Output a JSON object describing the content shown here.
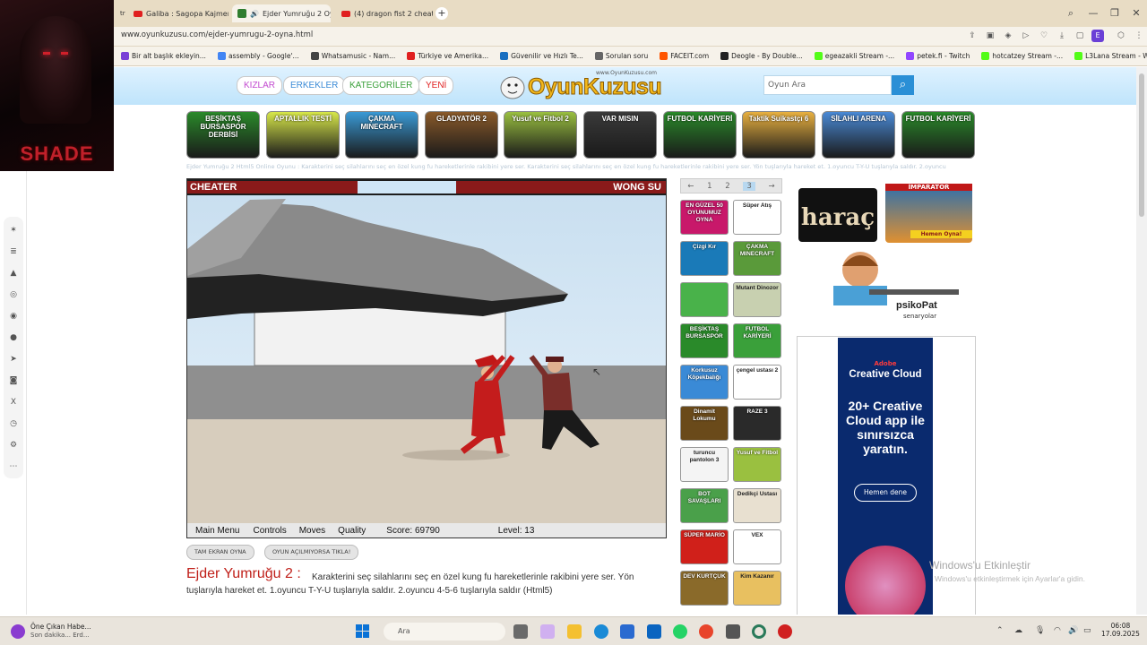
{
  "overlay": {
    "streamer_name": "SHADE"
  },
  "browser": {
    "tabs": [
      {
        "label": "Galiba : Sagopa Kajmer",
        "type": "youtube"
      },
      {
        "label": "Ejder Yumruğu 2 Oy",
        "type": "oyunkuzusu",
        "active": true
      },
      {
        "label": "(4) dragon fist 2 cheats",
        "type": "youtube"
      }
    ],
    "url": "www.oyunkuzusu.com/ejder-yumrugu-2-oyna.html",
    "profile_letter": "E",
    "bookmarks": [
      {
        "label": "Bir alt başlık ekleyin...",
        "color": "#7a3fd6"
      },
      {
        "label": "assembly - Google'...",
        "color": "#4285f4"
      },
      {
        "label": "Whatsamusic - Nam...",
        "color": "#444444"
      },
      {
        "label": "Türkiye ve Amerika...",
        "color": "#e02020"
      },
      {
        "label": "Güvenilir ve Hızlı Te...",
        "color": "#1a6fc0"
      },
      {
        "label": "Sorulan soru",
        "color": "#666666"
      },
      {
        "label": "FACEIT.com",
        "color": "#ff5500"
      },
      {
        "label": "Deogle - By Double...",
        "color": "#222222"
      },
      {
        "label": "egeazakli Stream -...",
        "color": "#53fc18"
      },
      {
        "label": "petek.fi - Twitch",
        "color": "#9146ff"
      },
      {
        "label": "hotcatzey Stream -...",
        "color": "#53fc18"
      },
      {
        "label": "L3Lana Stream - Wa...",
        "color": "#53fc18"
      }
    ]
  },
  "site": {
    "nav": {
      "kizlar": "KIZLAR",
      "erkekler": "ERKEKLER",
      "kategoriler": "KATEGORİLER",
      "yeni": "YENİ"
    },
    "logo": "OyunKuzusu",
    "logo_small": "www.OyunKuzusu.com",
    "search_placeholder": "Oyun Ara",
    "top_games": [
      {
        "label": "BEŞİKTAŞ BURSASPOR DERBİSİ",
        "color": "#2a8a2a"
      },
      {
        "label": "APTALLIK TESTİ",
        "color": "#d8e84a"
      },
      {
        "label": "ÇAKMA MINECRAFT",
        "color": "#3a9ad6"
      },
      {
        "label": "GLADYATÖR 2",
        "color": "#8a5a2a"
      },
      {
        "label": "Yusuf ve Fitbol 2",
        "color": "#9ac040"
      },
      {
        "label": "VAR MISIN",
        "color": "#3a3a3a"
      },
      {
        "label": "FUTBOL KARİYERİ",
        "color": "#2a8a2a"
      },
      {
        "label": "Taktik Suikastçı 6",
        "color": "#e8b040"
      },
      {
        "label": "SİLAHLI ARENA",
        "color": "#4a8ad6"
      },
      {
        "label": "FUTBOL KARİYERİ",
        "color": "#2a8a2a"
      }
    ],
    "breadcrumb": "Ejder Yumruğu 2 Html5 Online Oyunu : Karakterini seç silahlarını seç en özel kung fu hareketlerinle rakibini yere ser. Karakterini seç silahlarını seç en özel kung fu hareketlerinle rakibini yere ser. Yön tuşlarıyla hareket et. 1.oyuncu T-Y-U tuşlarıyla saldır. 2.oyuncu"
  },
  "game": {
    "player1": "CHEATER",
    "player2": "WONG SU",
    "menu": {
      "main_menu": "Main Menu",
      "controls": "Controls",
      "moves": "Moves",
      "quality": "Quality"
    },
    "score": "Score: 69790",
    "level": "Level: 13",
    "fullscreen_btn": "TAM EKRAN OYNA",
    "not_opening_btn": "OYUN AÇILMIYORSA TIKLA!",
    "title": "Ejder Yumruğu 2 :",
    "description": "Karakterini seç silahlarını seç en özel kung fu hareketlerinle rakibini yere ser. Yön tuşlarıyla hareket et. 1.oyuncu T-Y-U tuşlarıyla saldır. 2.oyuncu 4-5-6 tuşlarıyla saldır (Html5)"
  },
  "pager": {
    "prev": "←",
    "pages": [
      "1",
      "2",
      "3"
    ],
    "current": "3",
    "next": "→"
  },
  "side_games": [
    {
      "label": "EN GÜZEL 50 OYUNUMUZ OYNA",
      "color": "#c8186a"
    },
    {
      "label": "Süper Atış",
      "color": "#ffffff"
    },
    {
      "label": "Çizgi Kır",
      "color": "#1a7ab8"
    },
    {
      "label": "ÇAKMA MINECRAFT",
      "color": "#5a9a3a"
    },
    {
      "label": "",
      "color": "#49b24a"
    },
    {
      "label": "Mutant Dinozor",
      "color": "#c8d0b0"
    },
    {
      "label": "BEŞİKTAŞ BURSASPOR",
      "color": "#2a8a2a"
    },
    {
      "label": "FUTBOL KARİYERİ",
      "color": "#3aa03a"
    },
    {
      "label": "Korkusuz Köpekbalığı",
      "color": "#3a8ad6"
    },
    {
      "label": "çengel ustası 2",
      "color": "#ffffff"
    },
    {
      "label": "Dinamit Lokumu",
      "color": "#6a4a1a"
    },
    {
      "label": "RAZE 3",
      "color": "#2a2a2a"
    },
    {
      "label": "turuncu pantolon 3",
      "color": "#f4f4f4"
    },
    {
      "label": "Yusuf ve Fitbol",
      "color": "#9ac040"
    },
    {
      "label": "BOT SAVAŞLARI",
      "color": "#4aa04a"
    },
    {
      "label": "Dedikçi Ustası",
      "color": "#e8e0d0"
    },
    {
      "label": "SÜPER MARİO",
      "color": "#d0201a"
    },
    {
      "label": "VEX",
      "color": "#ffffff"
    },
    {
      "label": "DEV KURTÇUK",
      "color": "#8a6a2a"
    },
    {
      "label": "Kim Kazanır",
      "color": "#e8c060"
    }
  ],
  "ads": {
    "harac": "haraç",
    "imparator": "İMPARATOR",
    "imparator_cta": "Hemen Oyna!",
    "psiko": "psikoPat",
    "psiko_sub": "senaryolar",
    "adobe_brand": "Adobe",
    "adobe_product": "Creative Cloud",
    "adobe_headline": "20+ Creative Cloud app ile sınırsızca yaratın.",
    "adobe_cta": "Hemen dene"
  },
  "windows": {
    "watermark": "Windows'u Etkinleştir",
    "watermark_sub": "Windows'u etkinleştirmek için Ayarlar'a gidin.",
    "news_title": "Öne Çıkan Habe...",
    "news_sub": "Son dakika... Erd...",
    "search": "Ara",
    "time": "06:08",
    "date": "17.09.2025"
  }
}
